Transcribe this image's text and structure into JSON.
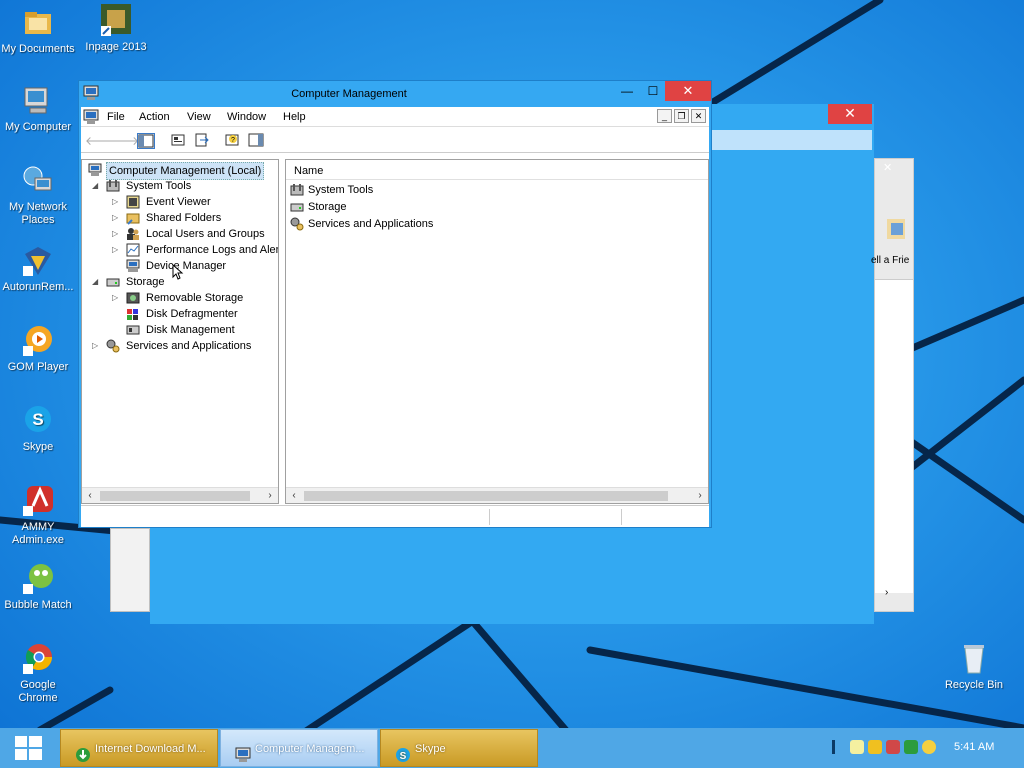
{
  "desktop": {
    "icons": [
      {
        "label": "My Documents",
        "icon": "folder-documents-icon"
      },
      {
        "label": "Inpage 2013",
        "icon": "inpage-icon"
      },
      {
        "label": "My Computer",
        "icon": "computer-icon"
      },
      {
        "label": "My Network Places",
        "icon": "network-icon"
      },
      {
        "label": "AutorunRem...",
        "icon": "autorun-icon"
      },
      {
        "label": "GOM Player",
        "icon": "gom-player-icon"
      },
      {
        "label": "Skype",
        "icon": "skype-icon"
      },
      {
        "label": "AMMY Admin.exe",
        "icon": "ammy-admin-icon"
      },
      {
        "label": "Bubble Match",
        "icon": "bubble-match-icon"
      },
      {
        "label": "Google Chrome",
        "icon": "chrome-icon"
      },
      {
        "label": "Recycle Bin",
        "icon": "recycle-bin-icon"
      }
    ]
  },
  "bg_window": {
    "close_glyph": "✕",
    "partial_label": "ell a Frie"
  },
  "window": {
    "title": "Computer Management",
    "minimize": "—",
    "maximize": "☐",
    "close": "✕",
    "menu": [
      "File",
      "Action",
      "View",
      "Window",
      "Help"
    ],
    "mdi_controls": [
      "_",
      "❐",
      "✕"
    ]
  },
  "tree": {
    "items": [
      {
        "label": "Computer Management (Local)",
        "twisty": "",
        "icon": "computer-management-icon"
      },
      {
        "label": "System Tools",
        "twisty": "◢",
        "icon": "system-tools-icon"
      },
      {
        "label": "Event Viewer",
        "twisty": "▷",
        "icon": "event-viewer-icon"
      },
      {
        "label": "Shared Folders",
        "twisty": "▷",
        "icon": "shared-folders-icon"
      },
      {
        "label": "Local Users and Groups",
        "twisty": "▷",
        "icon": "users-icon"
      },
      {
        "label": "Performance Logs and Alert",
        "twisty": "▷",
        "icon": "performance-icon"
      },
      {
        "label": "Device Manager",
        "twisty": "",
        "icon": "device-manager-icon"
      },
      {
        "label": "Storage",
        "twisty": "◢",
        "icon": "storage-icon"
      },
      {
        "label": "Removable Storage",
        "twisty": "▷",
        "icon": "removable-storage-icon"
      },
      {
        "label": "Disk Defragmenter",
        "twisty": "",
        "icon": "defragmenter-icon"
      },
      {
        "label": "Disk Management",
        "twisty": "",
        "icon": "disk-management-icon"
      },
      {
        "label": "Services and Applications",
        "twisty": "▷",
        "icon": "services-icon"
      }
    ]
  },
  "list": {
    "column_header": "Name",
    "items": [
      {
        "label": "System Tools",
        "icon": "system-tools-icon"
      },
      {
        "label": "Storage",
        "icon": "storage-icon"
      },
      {
        "label": "Services and Applications",
        "icon": "services-icon"
      }
    ]
  },
  "taskbar": {
    "tasks": [
      {
        "label": "Internet Download M...",
        "icon": "idm-icon"
      },
      {
        "label": "Computer Managem...",
        "icon": "computer-management-icon"
      },
      {
        "label": "Skype",
        "icon": "skype-icon"
      }
    ],
    "clock": "5:41 AM"
  }
}
